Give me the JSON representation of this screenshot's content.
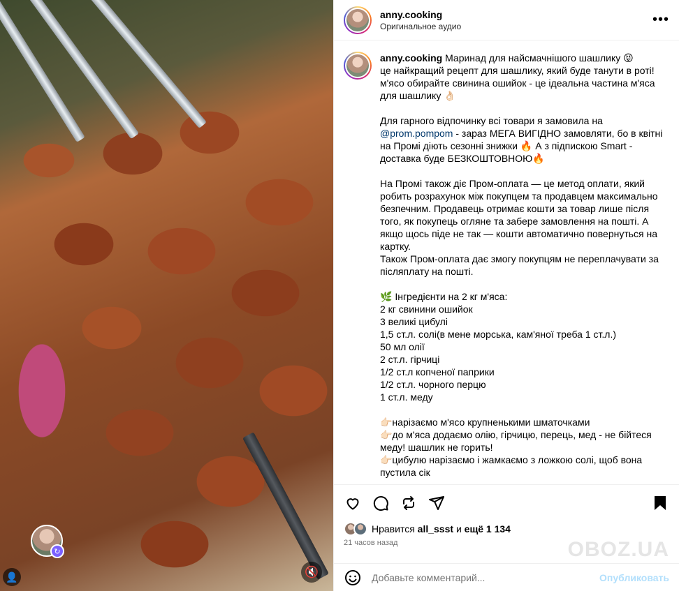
{
  "header": {
    "username": "anny.cooking",
    "subtitle": "Оригинальное аудио",
    "more_label": "•••"
  },
  "caption": {
    "username": "anny.cooking",
    "first_line": "Маринад для найсмачнішого шашлику 😝",
    "line2": "це найкращий рецепт для шашлику, який буде танути в роті!",
    "line3": "м'ясо обирайте свинина ошийок - це ідеальна частина м'яса для шашлику 👌🏻",
    "para2_pre": "Для гарного відпочинку всі товари я замовила на ",
    "para2_mention": "@prom.pompom",
    "para2_post": " - зараз МЕГА ВИГІДНО замовляти, бо в квітні на Промі діють сезонні знижки 🔥 А з підпискою Smart - доставка буде БЕЗКОШТОВНОЮ🔥",
    "para3": "На Промі також діє Пром-оплата — це метод оплати, який робить розрахунок між покупцем та продавцем максимально безпечним. Продавець отримає кошти за товар лише після того, як покупець огляне та забере замовлення на пошті. А якщо щось піде не так — кошти автоматично повернуться на картку.",
    "para3b": "Також Пром-оплата дає змогу покупцям не переплачувати за післяплату на пошті.",
    "ingredients_title": "🌿 Інгредієнти на 2 кг м'яса:",
    "ingredients": [
      "2 кг свинини ошийок",
      "3 великі цибулі",
      "1,5 ст.л. солі(в мене морська, кам'яної треба 1 ст.л.)",
      "50 мл олії",
      "2 ст.л. гірчиці",
      "1/2 ст.л копченої паприки",
      "1/2 ст.л. чорного перцю",
      "1 ст.л. меду"
    ],
    "steps": [
      "👉🏻нарізаємо м'ясо крупненькими шматочками",
      "👉🏻до м'яса додаємо олію, гірчицю, перець, мед - не бійтеся меду! шашлик не горить!",
      "👉🏻цибулю нарізаємо і жамкаємо з ложкою солі, щоб вона пустила сік"
    ]
  },
  "likes": {
    "prefix": "Нравится",
    "user": "all_ssst",
    "middle": "и",
    "others": "ещё 1 134"
  },
  "time": "21 часов назад",
  "comment": {
    "placeholder": "Добавьте комментарий...",
    "post_label": "Опубликовать"
  },
  "watermark": "OBOZ.UA",
  "icons": [
    "more-icon",
    "heart-icon",
    "comment-icon",
    "repost-icon",
    "share-icon",
    "bookmark-icon",
    "emoji-icon",
    "mute-icon",
    "user-tag-icon"
  ]
}
